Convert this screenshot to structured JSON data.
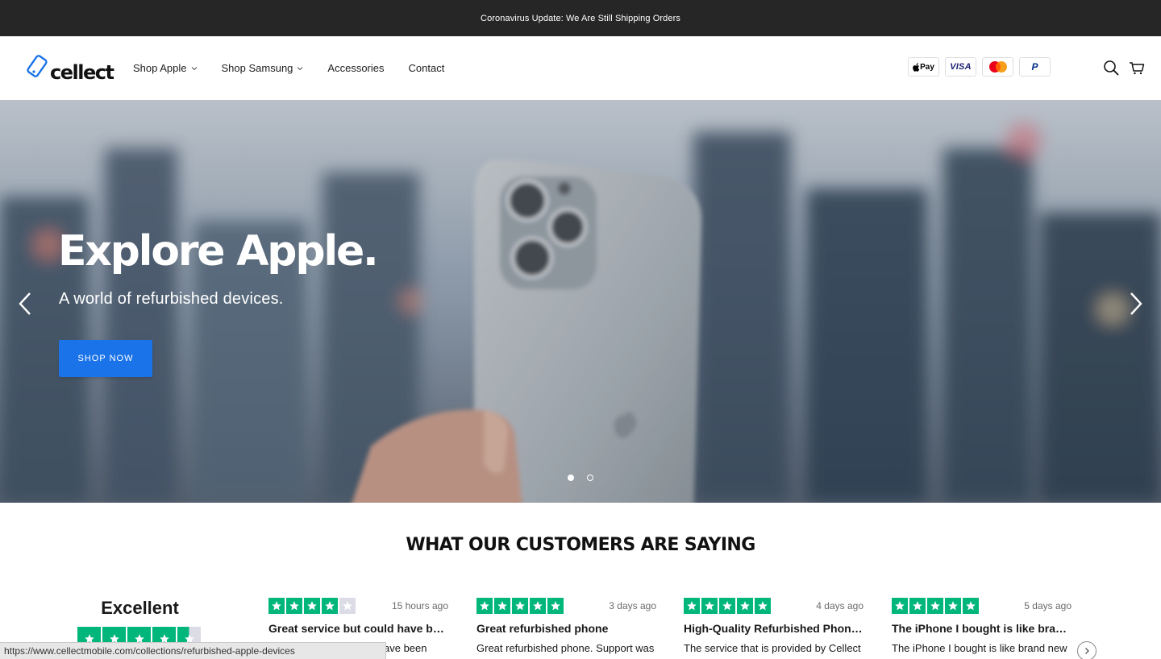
{
  "announcement": "Coronavirus Update: We Are Still Shipping Orders",
  "brand": {
    "name": "cellect",
    "accent": "#1a73e8"
  },
  "nav": {
    "items": [
      {
        "label": "Shop Apple",
        "has_dropdown": true
      },
      {
        "label": "Shop Samsung",
        "has_dropdown": true
      },
      {
        "label": "Accessories",
        "has_dropdown": false
      },
      {
        "label": "Contact",
        "has_dropdown": false
      }
    ]
  },
  "payments": {
    "applepay": "Pay",
    "visa": "VISA",
    "mastercard": "mastercard-icon",
    "paypal": "P"
  },
  "header_icons": [
    "search-icon",
    "cart-icon"
  ],
  "hero": {
    "title": "Explore Apple.",
    "subtitle": "A world of refurbished devices.",
    "cta": "SHOP NOW",
    "slide_count": 2,
    "active_slide": 1
  },
  "reviews": {
    "heading": "WHAT OUR CUSTOMERS ARE SAYING",
    "summary": {
      "rating_text": "Excellent",
      "stars": 4.5
    },
    "items": [
      {
        "stars": 4,
        "time": "15 hours ago",
        "title": "Great service but could have b…",
        "body": "ave been"
      },
      {
        "stars": 5,
        "time": "3 days ago",
        "title": "Great refurbished phone",
        "body": "Great refurbished phone. Support was"
      },
      {
        "stars": 5,
        "time": "4 days ago",
        "title": "High-Quality Refurbished Phon…",
        "body": "The service that is provided by Cellect"
      },
      {
        "stars": 5,
        "time": "5 days ago",
        "title": "The iPhone I bought is like bra…",
        "body": "The iPhone I bought is like brand new"
      }
    ],
    "star_color": "#00b67a"
  },
  "status_url": "https://www.cellectmobile.com/collections/refurbished-apple-devices"
}
